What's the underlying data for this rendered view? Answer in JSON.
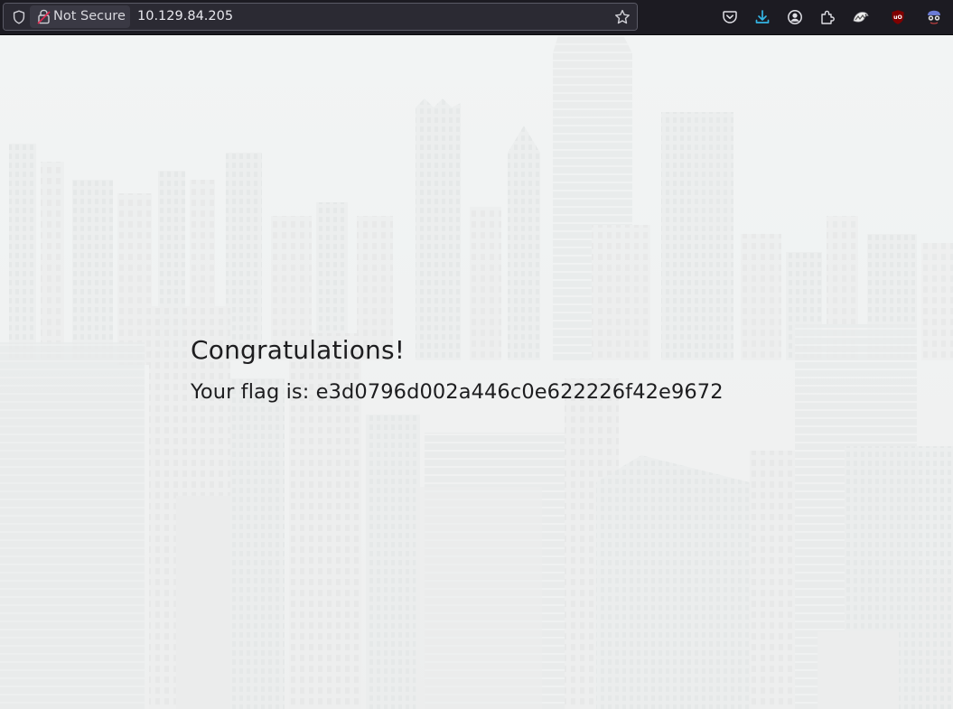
{
  "browser": {
    "security_label": "Not Secure",
    "url": "10.129.84.205",
    "icons": {
      "shield": "tracking-protection-shield-icon",
      "lock": "insecure-lock-icon",
      "bookmark": "bookmark-star-icon",
      "toolbar": [
        "pocket-icon",
        "downloads-icon",
        "account-icon",
        "extensions-icon",
        "foxyproxy-icon",
        "ublock-origin-icon",
        "wappalyzer-icon"
      ]
    },
    "colors": {
      "toolbar_bg": "#1c1b22",
      "download_accent": "#33b5e5",
      "ublock_red": "#800000"
    }
  },
  "page": {
    "heading": "Congratulations!",
    "flag_text": "Your flag is: e3d0796d002a446c0e622226f42e9672",
    "background": "faded-city-skyline-image"
  }
}
